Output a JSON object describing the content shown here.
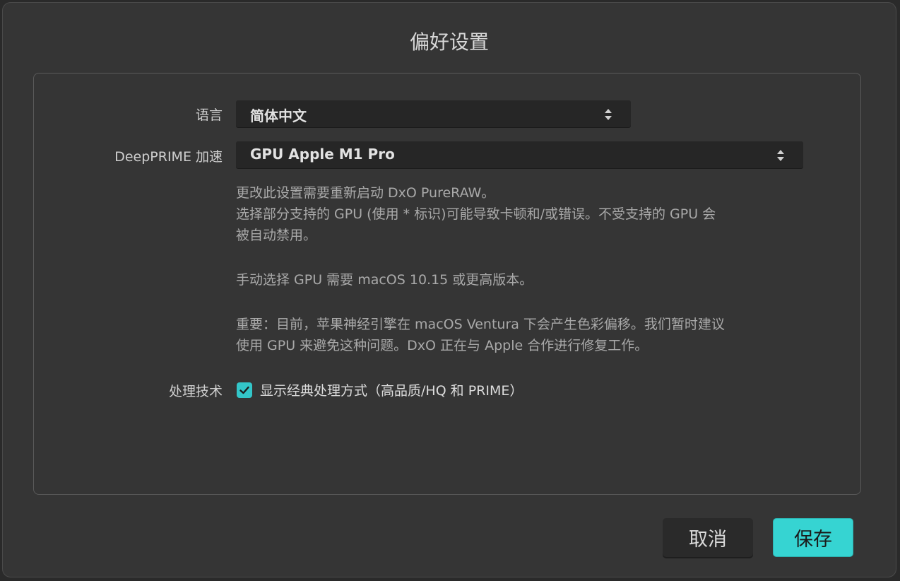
{
  "dialog": {
    "title": "偏好设置"
  },
  "language": {
    "label": "语言",
    "selected": "简体中文"
  },
  "deepprime": {
    "label": "DeepPRIME 加速",
    "selected": "GPU Apple M1 Pro"
  },
  "info": {
    "line1": "更改此设置需要重新启动 DxO PureRAW。",
    "line2": "选择部分支持的 GPU (使用 * 标识)可能导致卡顿和/或错误。不受支持的 GPU 会",
    "line3": "被自动禁用。",
    "line4": "手动选择 GPU 需要 macOS 10.15 或更高版本。",
    "line5": "重要：目前，苹果神经引擎在 macOS Ventura 下会产生色彩偏移。我们暂时建议",
    "line6": "使用 GPU 来避免这种问题。DxO 正在与 Apple 合作进行修复工作。"
  },
  "processing": {
    "label": "处理技术",
    "checkbox_label": "显示经典处理方式（高品质/HQ 和 PRIME）",
    "checked": true
  },
  "buttons": {
    "cancel": "取消",
    "save": "保存"
  },
  "colors": {
    "accent": "#36d4d2",
    "background": "#353535",
    "field": "#262626"
  },
  "icons": {
    "select_arrows": "up-down-chevron-icon",
    "check": "checkmark-icon"
  }
}
